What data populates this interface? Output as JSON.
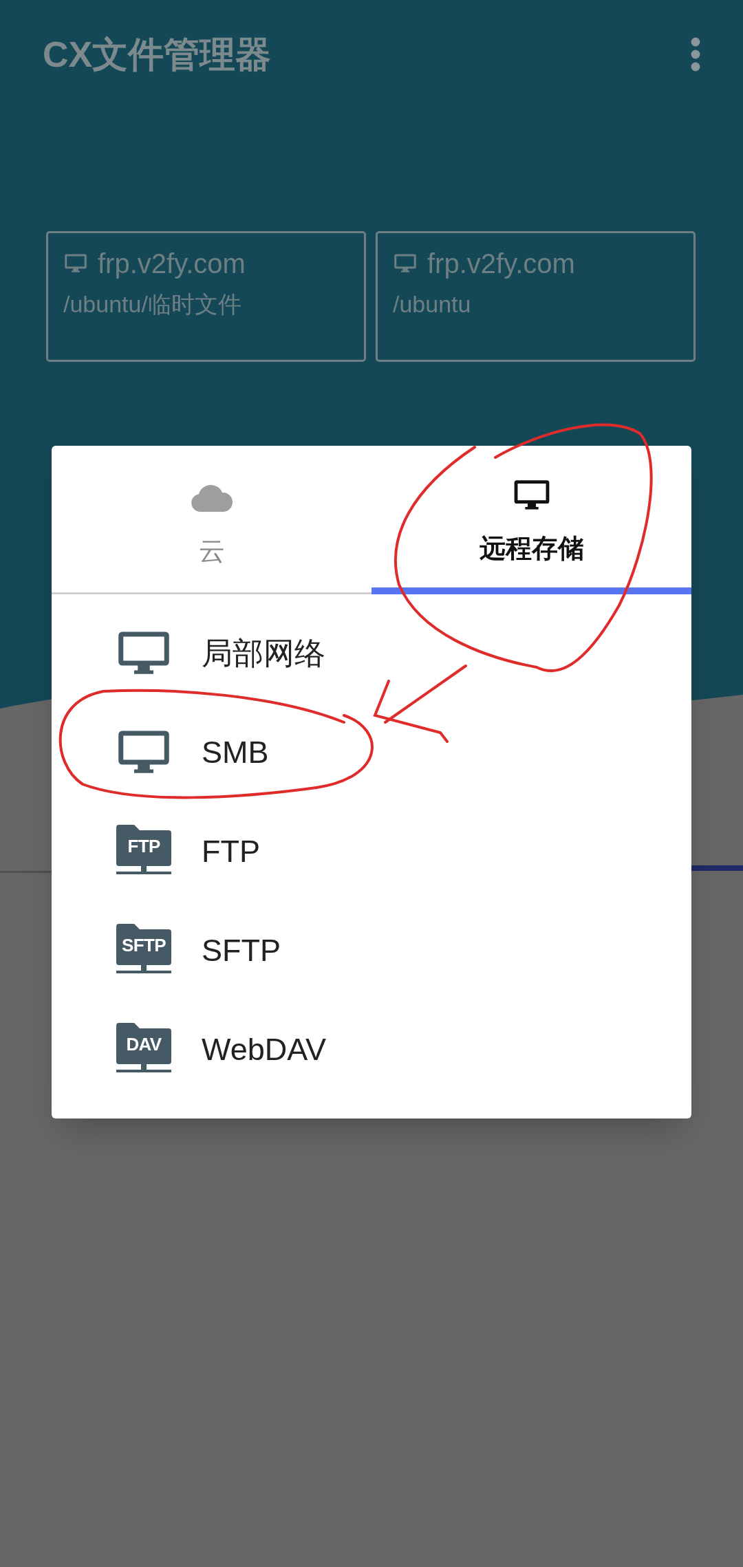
{
  "app_bar": {
    "title": "CX文件管理器"
  },
  "recent_locations": [
    {
      "host": "frp.v2fy.com",
      "path": "/ubuntu/临时文件"
    },
    {
      "host": "frp.v2fy.com",
      "path": "/ubuntu"
    }
  ],
  "dialog": {
    "tabs": [
      {
        "kind": "cloud",
        "label": "云",
        "selected": false
      },
      {
        "kind": "monitor",
        "label": "远程存储",
        "selected": true
      }
    ],
    "items": [
      {
        "kind": "monitor",
        "label": "局部网络"
      },
      {
        "kind": "monitor",
        "label": "SMB"
      },
      {
        "kind": "folder",
        "badge": "FTP",
        "label": "FTP"
      },
      {
        "kind": "folder",
        "badge": "SFTP",
        "label": "SFTP"
      },
      {
        "kind": "folder",
        "badge": "DAV",
        "label": "WebDAV"
      }
    ]
  }
}
